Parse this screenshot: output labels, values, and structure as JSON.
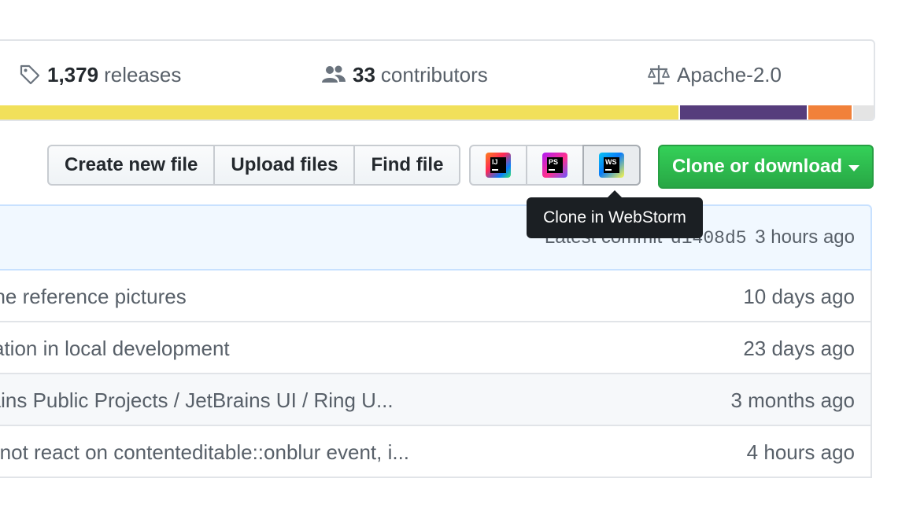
{
  "stats": {
    "releases": {
      "count": "1,379",
      "label": "releases",
      "icon": "tag-icon"
    },
    "contributors": {
      "count": "33",
      "label": "contributors",
      "icon": "people-icon"
    },
    "license": {
      "label": "Apache-2.0",
      "icon": "law-icon"
    }
  },
  "language_bar": {
    "segments": [
      {
        "color": "#f1e05a",
        "share": 0.782
      },
      {
        "color": "#563d7c",
        "share": 0.145
      },
      {
        "color": "#f1813a",
        "share": 0.05
      },
      {
        "color": "#e4e4e4",
        "share": 0.023
      }
    ]
  },
  "file_actions": {
    "create_label": "Create new file",
    "upload_label": "Upload files",
    "find_label": "Find file"
  },
  "ide_buttons": [
    {
      "name": "IntelliJ IDEA",
      "abbr": "IJ",
      "icon": "intellij-icon"
    },
    {
      "name": "PhpStorm",
      "abbr": "PS",
      "icon": "phpstorm-icon"
    },
    {
      "name": "WebStorm",
      "abbr": "WS",
      "icon": "webstorm-icon"
    }
  ],
  "clone_button": {
    "label": "Clone or download"
  },
  "tooltip": {
    "text": "Clone in WebStorm"
  },
  "latest_commit": {
    "prefix": "Latest commit",
    "sha": "d1408d5",
    "time": "3 hours ago"
  },
  "files": [
    {
      "message": "one reference pictures",
      "age": "10 days ago"
    },
    {
      "message": "sation in local development",
      "age": "23 days ago"
    },
    {
      "message": "rains Public Projects / JetBrains UI / Ring U...",
      "age": "3 months ago"
    },
    {
      "message": "o not react on contenteditable::onblur event, i...",
      "age": "4 hours ago"
    }
  ]
}
